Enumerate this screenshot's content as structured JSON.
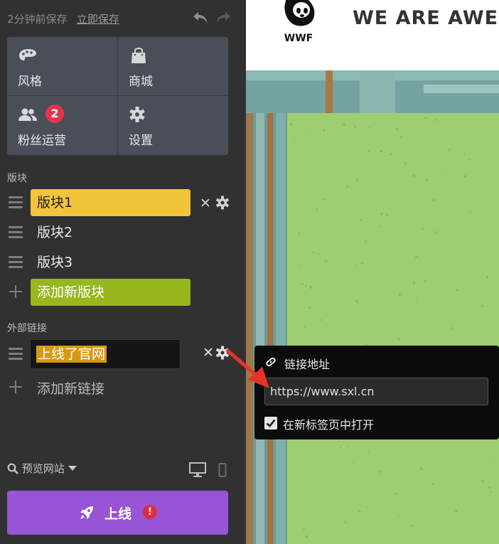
{
  "topbar": {
    "saved_text": "2分钟前保存",
    "save_now": "立即保存"
  },
  "grid": {
    "tiles": [
      {
        "label": "风格",
        "icon": "palette-icon"
      },
      {
        "label": "商城",
        "icon": "shopping-bag-icon"
      },
      {
        "label": "粉丝运营",
        "icon": "users-icon",
        "badge": "2"
      },
      {
        "label": "设置",
        "icon": "gear-icon"
      }
    ]
  },
  "sections": {
    "blocks_label": "版块",
    "links_label": "外部链接"
  },
  "blocks": [
    {
      "label": "版块1",
      "state": "active"
    },
    {
      "label": "版块2",
      "state": "normal"
    },
    {
      "label": "版块3",
      "state": "normal"
    }
  ],
  "add_block_label": "添加新版块",
  "links": [
    {
      "label": "上线了官网"
    }
  ],
  "add_link_label": "添加新链接",
  "footer": {
    "preview_label": "预览网站",
    "publish_label": "上线",
    "publish_alert": "!"
  },
  "site": {
    "heading": "WE ARE AWES",
    "logo_text": "WWF"
  },
  "popover": {
    "title": "链接地址",
    "url": "https://www.sxl.cn",
    "new_tab_label": "在新标签页中打开",
    "new_tab_checked": true
  },
  "colors": {
    "sidebar_bg": "#313131",
    "tile_bg": "#4a4e58",
    "active_block": "#f2c43b",
    "add_block": "#97b71c",
    "publish": "#9754d5",
    "badge": "#e5354a",
    "arrow": "#e8332a"
  }
}
